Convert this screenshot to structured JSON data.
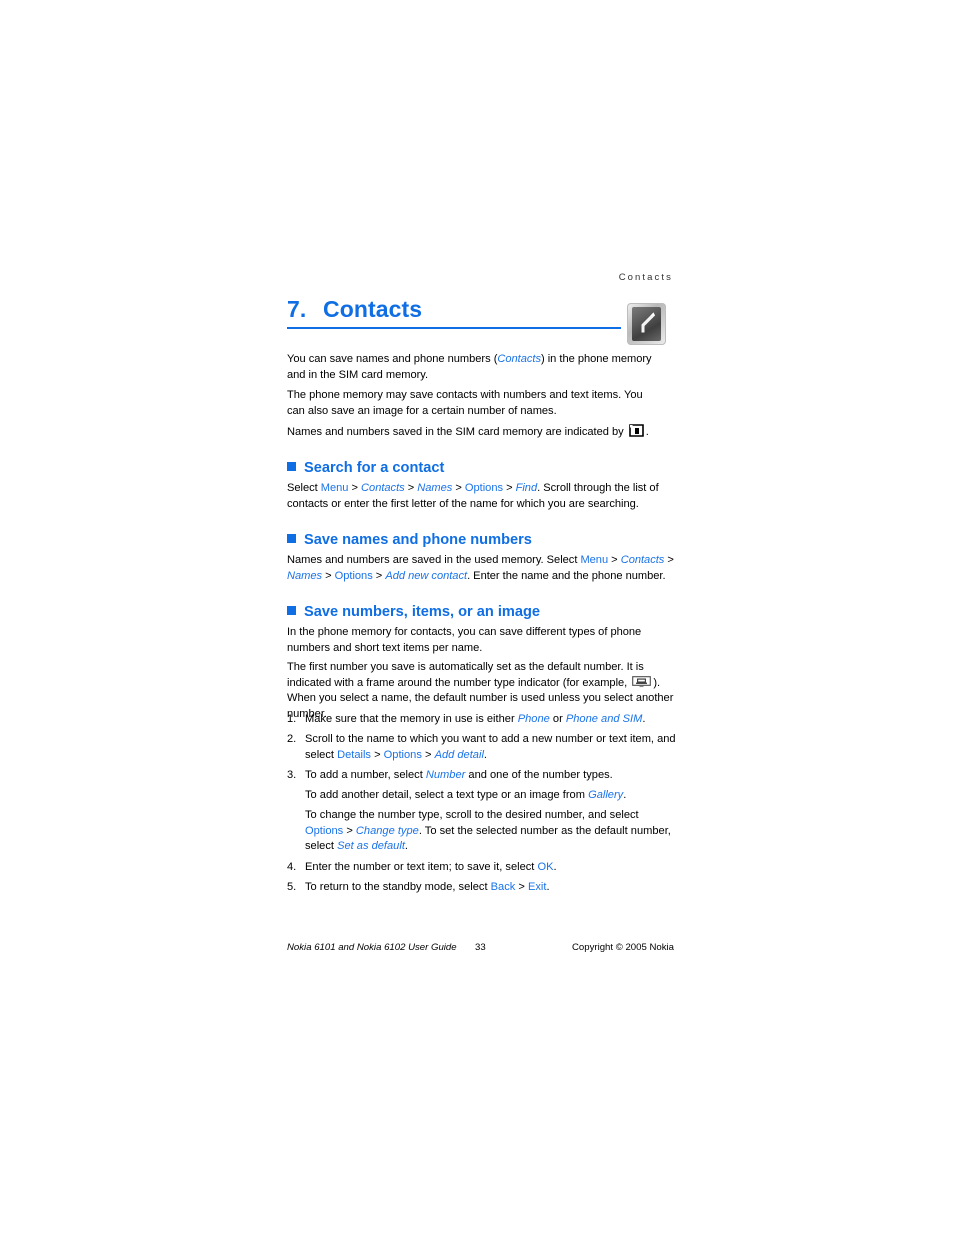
{
  "header": {
    "running_head": "Contacts"
  },
  "chapter": {
    "number": "7.",
    "title": "Contacts",
    "icon_name": "contacts-chapter-icon"
  },
  "intro": {
    "p1_a": "You can save names and phone numbers (",
    "p1_link": "Contacts",
    "p1_b": ") in the phone memory and in the SIM card memory.",
    "p2": "The phone memory may save contacts with numbers and text items. You can also save an image for a certain number of names.",
    "p3_a": "Names and numbers saved in the SIM card memory are indicated by",
    "p3_icon": "sim-card-icon",
    "p3_b": "."
  },
  "sections": [
    {
      "heading": "Search for a contact",
      "body": {
        "select": "Select",
        "menu": "Menu",
        "contacts": "Contacts",
        "names": "Names",
        "options": "Options",
        "find": "Find",
        "tail": ". Scroll through the list of contacts or enter the first letter of the name for which you are searching.",
        "sep": ">"
      }
    },
    {
      "heading": "Save names and phone numbers",
      "body": {
        "lead": "Names and numbers are saved in the used memory. Select",
        "menu": "Menu",
        "contacts": "Contacts",
        "names": "Names",
        "options": "Options",
        "add_new_contact": "Add new contact",
        "tail": ". Enter the name and the phone number.",
        "sep": ">"
      }
    },
    {
      "heading": "Save numbers, items, or an image",
      "body": {
        "p1": "In the phone memory for contacts, you can save different types of phone numbers and short text items per name.",
        "p2_a": "The first number you save is automatically set as the default number. It is indicated with a frame around the number type indicator (for example,",
        "p2_icon": "number-type-indicator-icon",
        "p2_b": "). When you select a name, the default number is used unless you select another number."
      }
    }
  ],
  "steps": [
    {
      "num": "1.",
      "a": "Make sure that the memory in use is either ",
      "link1": "Phone",
      "mid": " or ",
      "link2": "Phone and SIM",
      "b": "."
    },
    {
      "num": "2.",
      "a": "Scroll to the name to which you want to add a new number or text item, and select ",
      "link1": "Details",
      "sep1": ">",
      "link2": "Options",
      "sep2": ">",
      "link3": "Add detail",
      "b": "."
    },
    {
      "num": "3.",
      "a": "To add a number, select ",
      "link1": "Number",
      "b": " and one of the number types.",
      "sub": [
        {
          "a": "To add another detail, select a text type or an image from ",
          "link1": "Gallery",
          "b": "."
        },
        {
          "a": "To change the number type, scroll to the desired number, and select ",
          "link1": "Options",
          "sep1": ">",
          "link2": "Change type",
          "b": ". To set the selected number as the default number, select ",
          "link3": "Set as default",
          "c": "."
        }
      ]
    },
    {
      "num": "4.",
      "a": "Enter the number or text item; to save it, select ",
      "link1": "OK",
      "b": "."
    },
    {
      "num": "5.",
      "a": "To return to the standby mode, select ",
      "link1": "Back",
      "sep1": ">",
      "link2": "Exit",
      "b": "."
    }
  ],
  "footer": {
    "guide": "Nokia 6101 and Nokia 6102 User Guide",
    "page": "33",
    "copyright": "Copyright © 2005 Nokia"
  },
  "colors": {
    "accent_blue": "#0f6ee4",
    "link_blue": "#1a73e8",
    "page_background": "#ffffff",
    "text": "#000000"
  }
}
